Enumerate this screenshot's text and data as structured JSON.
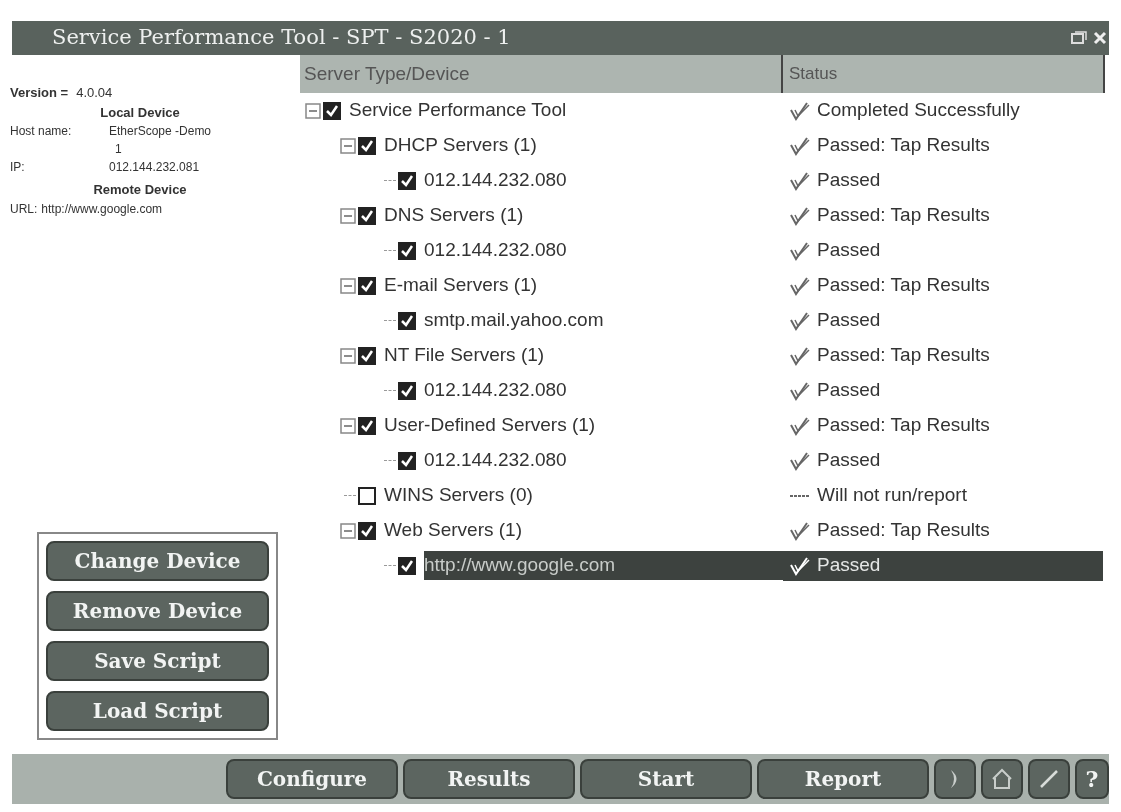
{
  "window": {
    "title": "Service Performance Tool - SPT - S2020 - 1"
  },
  "info": {
    "version_label": "Version =",
    "version": "4.0.04",
    "local_heading": "Local Device",
    "host_label": "Host name:",
    "host_lines": [
      "EtherScope -Demo",
      "1"
    ],
    "ip_label": "IP:",
    "ip": "012.144.232.081",
    "remote_heading": "Remote Device",
    "url_label": "URL:",
    "url": "http://www.google.com"
  },
  "device_buttons": [
    "Change Device",
    "Remove Device",
    "Save Script",
    "Load Script"
  ],
  "table": {
    "columns": [
      "Server Type/Device",
      "Status"
    ],
    "tree": [
      {
        "label": "Service Performance Tool",
        "checked": true,
        "expanded": true,
        "selected": false,
        "status": {
          "kind": "check",
          "text": "Completed Successfully"
        },
        "children": [
          {
            "label": "DHCP Servers (1)",
            "checked": true,
            "expanded": true,
            "selected": false,
            "status": {
              "kind": "check",
              "text": "Passed: Tap Results"
            },
            "children": [
              {
                "label": "012.144.232.080",
                "checked": true,
                "selected": false,
                "status": {
                  "kind": "check",
                  "text": "Passed"
                }
              }
            ]
          },
          {
            "label": "DNS Servers (1)",
            "checked": true,
            "expanded": true,
            "selected": false,
            "status": {
              "kind": "check",
              "text": "Passed: Tap Results"
            },
            "children": [
              {
                "label": "012.144.232.080",
                "checked": true,
                "selected": false,
                "status": {
                  "kind": "check",
                  "text": "Passed"
                }
              }
            ]
          },
          {
            "label": "E-mail Servers (1)",
            "checked": true,
            "expanded": true,
            "selected": false,
            "status": {
              "kind": "check",
              "text": "Passed: Tap Results"
            },
            "children": [
              {
                "label": "smtp.mail.yahoo.com",
                "checked": true,
                "selected": false,
                "status": {
                  "kind": "check",
                  "text": "Passed"
                }
              }
            ]
          },
          {
            "label": "NT File Servers (1)",
            "checked": true,
            "expanded": true,
            "selected": false,
            "status": {
              "kind": "check",
              "text": "Passed: Tap Results"
            },
            "children": [
              {
                "label": "012.144.232.080",
                "checked": true,
                "selected": false,
                "status": {
                  "kind": "check",
                  "text": "Passed"
                }
              }
            ]
          },
          {
            "label": "User-Defined Servers (1)",
            "checked": true,
            "expanded": true,
            "selected": false,
            "status": {
              "kind": "check",
              "text": "Passed: Tap Results"
            },
            "children": [
              {
                "label": "012.144.232.080",
                "checked": true,
                "selected": false,
                "status": {
                  "kind": "check",
                  "text": "Passed"
                }
              }
            ]
          },
          {
            "label": "WINS Servers (0)",
            "checked": false,
            "selected": false,
            "status": {
              "kind": "dash",
              "text": "Will not run/report"
            }
          },
          {
            "label": "Web Servers (1)",
            "checked": true,
            "expanded": true,
            "selected": false,
            "status": {
              "kind": "check",
              "text": "Passed: Tap Results"
            },
            "children": [
              {
                "label": "http://www.google.com",
                "checked": true,
                "selected": true,
                "status": {
                  "kind": "check",
                  "text": "Passed"
                }
              }
            ]
          }
        ]
      }
    ]
  },
  "bottom_buttons": [
    "Configure",
    "Results",
    "Start",
    "Report"
  ],
  "help_button": "?"
}
